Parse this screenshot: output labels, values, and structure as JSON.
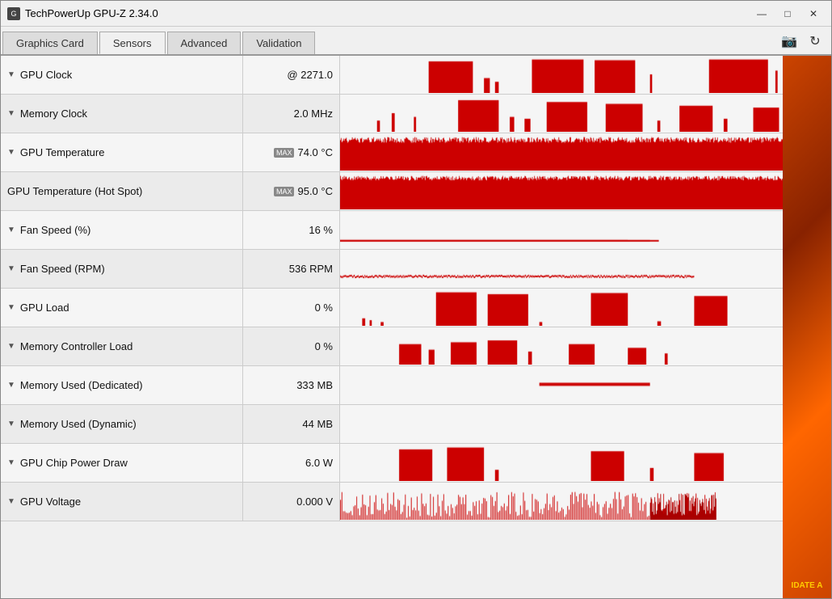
{
  "window": {
    "title": "TechPowerUp GPU-Z 2.34.0",
    "icon": "GPU"
  },
  "titlebar": {
    "minimize_label": "—",
    "maximize_label": "□",
    "close_label": "✕"
  },
  "tabs": [
    {
      "id": "graphics-card",
      "label": "Graphics Card",
      "active": false
    },
    {
      "id": "sensors",
      "label": "Sensors",
      "active": true
    },
    {
      "id": "advanced",
      "label": "Advanced",
      "active": false
    },
    {
      "id": "validation",
      "label": "Validation",
      "active": false
    }
  ],
  "toolbar": {
    "screenshot_icon": "📷",
    "refresh_icon": "↻"
  },
  "sensors": [
    {
      "name": "GPU Clock",
      "has_dropdown": true,
      "has_max": false,
      "value": "@ 2271.0",
      "unit": "",
      "graph_style": "spiky_high"
    },
    {
      "name": "Memory Clock",
      "has_dropdown": true,
      "has_max": false,
      "value": "2.0",
      "unit": "MHz",
      "graph_style": "spiky_medium"
    },
    {
      "name": "GPU Temperature",
      "has_dropdown": true,
      "has_max": true,
      "value": "74.0",
      "unit": "°C",
      "graph_style": "flat_high"
    },
    {
      "name": "GPU Temperature (Hot Spot)",
      "has_dropdown": false,
      "has_max": true,
      "value": "95.0",
      "unit": "°C",
      "graph_style": "flat_high2"
    },
    {
      "name": "Fan Speed (%)",
      "has_dropdown": true,
      "has_max": false,
      "value": "16",
      "unit": "%",
      "graph_style": "flat_low"
    },
    {
      "name": "Fan Speed (RPM)",
      "has_dropdown": true,
      "has_max": false,
      "value": "536",
      "unit": "RPM",
      "graph_style": "flat_medium"
    },
    {
      "name": "GPU Load",
      "has_dropdown": true,
      "has_max": false,
      "value": "0",
      "unit": "%",
      "graph_style": "spiky_blocks"
    },
    {
      "name": "Memory Controller Load",
      "has_dropdown": true,
      "has_max": false,
      "value": "0",
      "unit": "%",
      "graph_style": "small_spikes"
    },
    {
      "name": "Memory Used (Dedicated)",
      "has_dropdown": true,
      "has_max": false,
      "value": "333",
      "unit": "MB",
      "graph_style": "flat_dash"
    },
    {
      "name": "Memory Used (Dynamic)",
      "has_dropdown": true,
      "has_max": false,
      "value": "44",
      "unit": "MB",
      "graph_style": "empty"
    },
    {
      "name": "GPU Chip Power Draw",
      "has_dropdown": true,
      "has_max": false,
      "value": "6.0",
      "unit": "W",
      "graph_style": "spiky_blocks2"
    },
    {
      "name": "GPU Voltage",
      "has_dropdown": true,
      "has_max": false,
      "value": "0.000",
      "unit": "V",
      "graph_style": "dense_spikes"
    }
  ]
}
